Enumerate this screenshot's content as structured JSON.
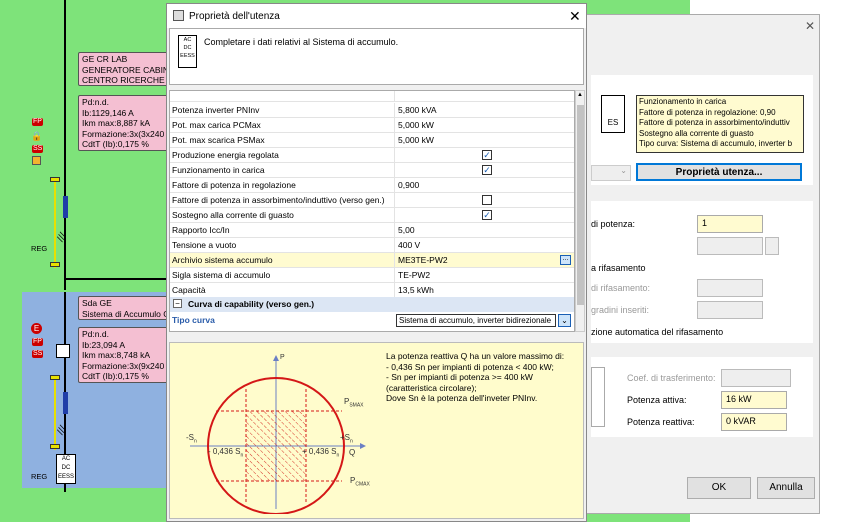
{
  "diagram": {
    "box1_lines": [
      "GE CR LAB",
      "GENERATORE CABINA",
      "CENTRO RICERCHE"
    ],
    "box2_lines": [
      "Pd:n.d.",
      "Ib:1129,146 A",
      "Ikm max:8,887 kA",
      "Formazione:3x(3x240",
      "CdtT (Ib):0,175 %"
    ],
    "box3_lines": [
      "Sda GE",
      "Sistema di Accumulo G"
    ],
    "box4_lines": [
      "Pd:n.d.",
      "Ib:23,094 A",
      "Ikm max:8,748 kA",
      "Formazione:3x(9x240",
      "CdtT (Ib):0,175 %"
    ],
    "reg1": "REG",
    "reg2": "REG",
    "ess_lines": [
      "AC",
      "DC",
      "EESS"
    ]
  },
  "dialog": {
    "title": "Proprietà dell'utenza",
    "description": "Completare i dati relativi al Sistema di accumulo.",
    "rows": [
      {
        "label": "Potenza inverter PNInv",
        "value": "5,800 kVA"
      },
      {
        "label": "Pot. max carica PCMax",
        "value": "5,000 kW"
      },
      {
        "label": "Pot. max scarica PSMax",
        "value": "5,000 kW"
      },
      {
        "label": "Produzione energia regolata",
        "checked": true
      },
      {
        "label": "Funzionamento in carica",
        "checked": true
      },
      {
        "label": "Fattore di potenza in regolazione",
        "value": "0,900"
      },
      {
        "label": "Fattore di potenza in assorbimento/induttivo (verso gen.)",
        "checked": false
      },
      {
        "label": "Sostegno alla corrente di guasto",
        "checked": true
      },
      {
        "label": "Rapporto Icc/In",
        "value": "5,00"
      },
      {
        "label": "Tensione a vuoto",
        "value": "400 V"
      },
      {
        "label": "Archivio sistema accumulo",
        "value": "ME3TE-PW2"
      },
      {
        "label": "Sigla sistema di accumulo",
        "value": "TE-PW2"
      },
      {
        "label": "Capacità",
        "value": "13,5 kWh"
      }
    ],
    "section_label": "Curva di capability (verso gen.)",
    "tipo_curva_label": "Tipo curva",
    "tipo_curva_value": "Sistema di accumulo, inverter bidirezionale",
    "info_text": "La potenza reattiva Q ha un valore massimo di:\n- 0,436 Sn per impianti di potenza < 400 kW;\n- Sn per impianti di potenza >= 400 kW\n(caratteristica circolare);\nDove Sn è la potenza dell'inveter PNInv.",
    "diagram_labels": {
      "p": "P",
      "q": "Q",
      "psmax": "P",
      "psmax_sub": "SMAX",
      "pcmax": "P",
      "pcmax_sub": "CMAX",
      "neg_sn": "-S",
      "pos_sn": "+S",
      "neg_q": "- 0,436 S",
      "pos_q": "+ 0,436 S",
      "sub_n": "n"
    }
  },
  "back_dialog": {
    "info_lines": [
      "Funzionamento in carica",
      "Fattore di potenza in regolazione: 0,90",
      "Fattore di potenza in assorbimento/induttiv",
      "Sostegno alla corrente di guasto",
      "Tipo curva: Sistema di accumulo, inverter b"
    ],
    "props_button": "Proprietà utenza...",
    "potenza_label": "di potenza:",
    "potenza_value": "1",
    "rifasamento1": "a rifasamento",
    "rifasamento2": "di rifasamento:",
    "gradini": "gradini inseriti:",
    "automatica": "zione automatica del rifasamento",
    "coef_label": "Coef. di trasferimento:",
    "attiva_label": "Potenza attiva:",
    "attiva_value": "16 kW",
    "reattiva_label": "Potenza reattiva:",
    "reattiva_value": "0 kVAR",
    "ok": "OK",
    "annulla": "Annulla",
    "es_label": "ES"
  }
}
